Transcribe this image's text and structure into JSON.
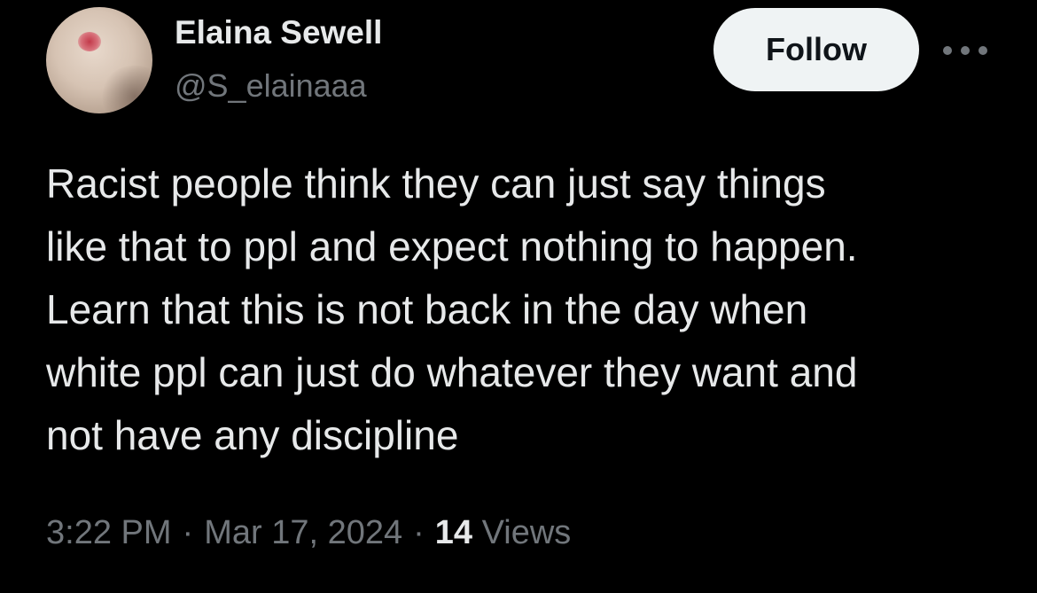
{
  "author": {
    "display_name": "Elaina Sewell",
    "handle": "@S_elainaaa",
    "avatar_icon": "profile-photo"
  },
  "actions": {
    "follow_label": "Follow",
    "more_icon": "more-horizontal-icon"
  },
  "tweet": {
    "text": "Racist people think they can just say things\nlike that to ppl and expect nothing to happen.\nLearn that this is not back in the day when\nwhite ppl can just do whatever they want and\nnot have any discipline"
  },
  "meta": {
    "time": "3:22 PM",
    "separator": "·",
    "date": "Mar 17, 2024",
    "views_count": "14",
    "views_label": "Views"
  },
  "colors": {
    "background": "#000000",
    "primary_text": "#e7e9ea",
    "secondary_text": "#71767b",
    "follow_button_bg": "#eff3f4",
    "follow_button_text": "#0f1419"
  }
}
